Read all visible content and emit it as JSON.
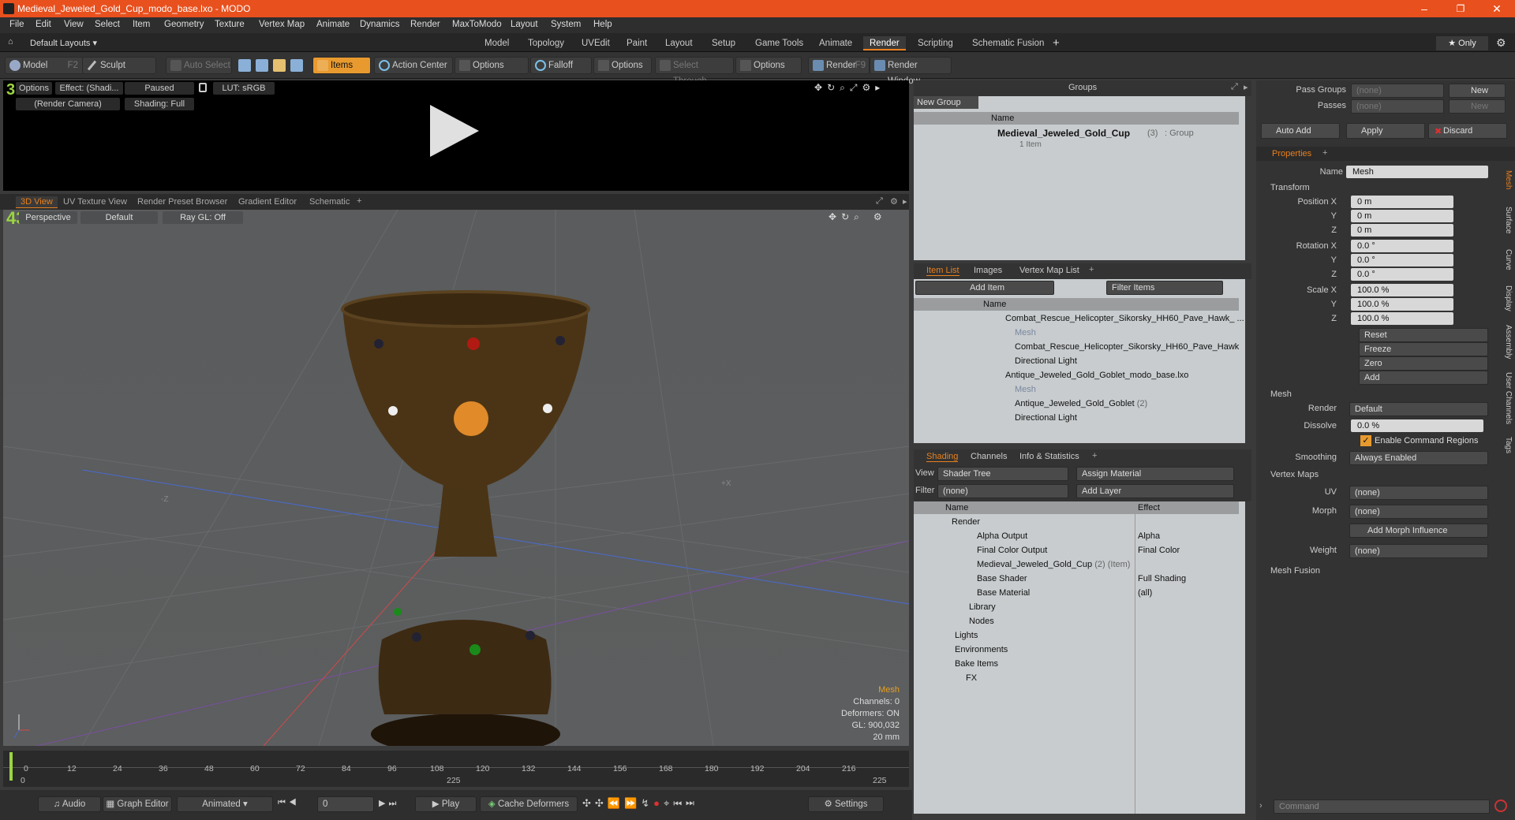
{
  "window": {
    "title": "Medieval_Jeweled_Gold_Cup_modo_base.lxo - MODO",
    "minimize": "–",
    "maximize": "❐",
    "close": "✕"
  },
  "menu": [
    "File",
    "Edit",
    "View",
    "Select",
    "Item",
    "Geometry",
    "Texture",
    "Vertex Map",
    "Animate",
    "Dynamics",
    "Render",
    "MaxToModo",
    "Layout",
    "System",
    "Help"
  ],
  "layouts": {
    "label": "Default Layouts ▾",
    "tabs": [
      "Model",
      "Topology",
      "UVEdit",
      "Paint",
      "Layout",
      "Setup",
      "Game Tools",
      "Animate",
      "Render",
      "Scripting",
      "Schematic Fusion"
    ],
    "active": "Render",
    "plus": "+",
    "only": "★ Only"
  },
  "toolbar": {
    "model": "Model",
    "model_key": "F2",
    "sculpt": "Sculpt",
    "auto_select": "Auto Select",
    "items": "Items",
    "action_center": "Action Center",
    "options1": "Options",
    "falloff": "Falloff",
    "options2": "Options",
    "select_through": "Select Through",
    "options3": "Options",
    "render": "Render",
    "render_key": "F9",
    "render_window": "Render Window"
  },
  "preview": {
    "options": "Options",
    "effect": "Effect: (Shadi...",
    "paused": "Paused",
    "lut": "LUT: sRGB",
    "camera": "(Render Camera)",
    "shading": "Shading: Full"
  },
  "viewport": {
    "tabs": [
      "3D View",
      "UV Texture View",
      "Render Preset Browser",
      "Gradient Editor",
      "Schematic"
    ],
    "active": "3D View",
    "perspective": "Perspective",
    "default": "Default",
    "raygl": "Ray GL: Off",
    "stats": {
      "type": "Mesh",
      "channels": "Channels: 0",
      "deformers": "Deformers: ON",
      "gl": "GL: 900,032",
      "size": "20 mm"
    },
    "axis_x": "+X",
    "axis_z": "-Z"
  },
  "timeline": {
    "ticks": [
      "0",
      "12",
      "24",
      "36",
      "48",
      "60",
      "72",
      "84",
      "96",
      "108",
      "120",
      "132",
      "144",
      "156",
      "168",
      "180",
      "192",
      "204",
      "216"
    ],
    "start": "0",
    "mid": "225",
    "end": "225"
  },
  "bottom": {
    "audio": "Audio",
    "graph_editor": "Graph Editor",
    "animated": "Animated",
    "frame": "0",
    "play": "Play",
    "cache": "Cache Deformers",
    "settings": "Settings"
  },
  "groups": {
    "title": "Groups",
    "new_group": "New Group",
    "col_name": "Name",
    "item_name": "Medieval_Jeweled_Gold_Cup",
    "item_count": "(3)",
    "item_type": ": Group",
    "item_sub": "1 Item"
  },
  "itemlist": {
    "tabs": [
      "Item List",
      "Images",
      "Vertex Map List"
    ],
    "add_item": "Add Item",
    "filter": "Filter Items",
    "col_name": "Name",
    "rows": [
      {
        "indent": 0,
        "label": "Combat_Rescue_Helicopter_Sikorsky_HH60_Pave_Hawk_ ...",
        "grey": false
      },
      {
        "indent": 1,
        "label": "Mesh",
        "grey": true
      },
      {
        "indent": 1,
        "label": "Combat_Rescue_Helicopter_Sikorsky_HH60_Pave_Hawk",
        "grey": false
      },
      {
        "indent": 1,
        "label": "Directional Light",
        "grey": false
      },
      {
        "indent": 0,
        "label": "Antique_Jeweled_Gold_Goblet_modo_base.lxo",
        "grey": false
      },
      {
        "indent": 1,
        "label": "Mesh",
        "grey": true
      },
      {
        "indent": 1,
        "label": "Antique_Jeweled_Gold_Goblet",
        "count": "(2)",
        "grey": false
      },
      {
        "indent": 1,
        "label": "Directional Light",
        "grey": false
      }
    ]
  },
  "shading": {
    "tabs": [
      "Shading",
      "Channels",
      "Info & Statistics"
    ],
    "view_label": "View",
    "view": "Shader Tree",
    "assign": "Assign Material",
    "filter_label": "Filter",
    "filter": "(none)",
    "add_layer": "Add Layer",
    "col_name": "Name",
    "col_effect": "Effect",
    "rows": [
      {
        "indent": 0,
        "label": "Render",
        "effect": ""
      },
      {
        "indent": 1,
        "label": "Alpha Output",
        "effect": "Alpha"
      },
      {
        "indent": 1,
        "label": "Final Color Output",
        "effect": "Final Color"
      },
      {
        "indent": 1,
        "label": "Medieval_Jeweled_Gold_Cup",
        "count": "(2) (Item)",
        "effect": ""
      },
      {
        "indent": 1,
        "label": "Base Shader",
        "effect": "Full Shading"
      },
      {
        "indent": 1,
        "label": "Base Material",
        "effect": "(all)"
      },
      {
        "indent": 1,
        "label": "Library",
        "effect": ""
      },
      {
        "indent": 1,
        "label": "Nodes",
        "effect": ""
      },
      {
        "indent": 0,
        "label": "Lights",
        "effect": ""
      },
      {
        "indent": 0,
        "label": "Environments",
        "effect": ""
      },
      {
        "indent": 0,
        "label": "Bake Items",
        "effect": ""
      },
      {
        "indent": 0,
        "label": "FX",
        "effect": ""
      }
    ]
  },
  "passes": {
    "pass_groups": "Pass Groups",
    "passes": "Passes",
    "none": "(none)",
    "new": "New",
    "auto_add": "Auto Add",
    "apply": "Apply",
    "discard": "Discard"
  },
  "properties": {
    "tab": "Properties",
    "name_label": "Name",
    "name": "Mesh",
    "transform": "Transform",
    "pos": [
      "0 m",
      "0 m",
      "0 m"
    ],
    "rot": [
      "0.0 °",
      "0.0 °",
      "0.0 °"
    ],
    "scale": [
      "100.0 %",
      "100.0 %",
      "100.0 %"
    ],
    "position_x": "Position X",
    "rotation_x": "Rotation X",
    "scale_x": "Scale X",
    "y": "Y",
    "z": "Z",
    "reset": "Reset",
    "freeze": "Freeze",
    "zero": "Zero",
    "add": "Add",
    "mesh": "Mesh",
    "render_label": "Render",
    "render": "Default",
    "dissolve_label": "Dissolve",
    "dissolve": "0.0 %",
    "enable_cmd": "Enable Command Regions",
    "smoothing_label": "Smoothing",
    "smoothing": "Always Enabled",
    "vertex_maps": "Vertex Maps",
    "uv_label": "UV",
    "uv": "(none)",
    "morph_label": "Morph",
    "morph": "(none)",
    "add_morph": "Add Morph Influence",
    "weight_label": "Weight",
    "weight": "(none)",
    "mesh_fusion": "Mesh Fusion",
    "side_tabs": [
      "Mesh",
      "Surface",
      "Curve",
      "Display",
      "Assembly",
      "User Channels",
      "Tags"
    ],
    "command": "Command"
  }
}
